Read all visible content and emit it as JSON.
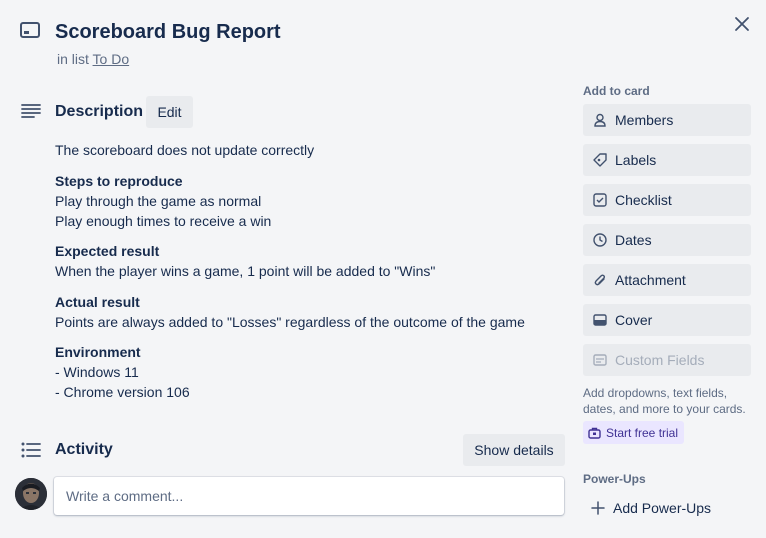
{
  "card": {
    "title": "Scoreboard Bug Report",
    "in_list_prefix": "in list",
    "list_name": "To Do"
  },
  "description": {
    "heading": "Description",
    "edit_label": "Edit",
    "intro": "The scoreboard does not update correctly",
    "steps_heading": "Steps to reproduce",
    "steps": [
      "Play through the game as normal",
      "Play enough times to receive a win"
    ],
    "expected_heading": "Expected result",
    "expected": "When the player wins a game, 1 point will be added to \"Wins\"",
    "actual_heading": "Actual result",
    "actual": "Points are always added to \"Losses\" regardless of the outcome of the game",
    "env_heading": "Environment",
    "env": [
      "- Windows 11",
      "- Chrome version 106"
    ]
  },
  "activity": {
    "heading": "Activity",
    "show_details_label": "Show details",
    "comment_placeholder": "Write a comment..."
  },
  "sidebar": {
    "add_to_card_heading": "Add to card",
    "buttons": [
      {
        "label": "Members",
        "icon": "person-icon"
      },
      {
        "label": "Labels",
        "icon": "tag-icon"
      },
      {
        "label": "Checklist",
        "icon": "checkbox-icon"
      },
      {
        "label": "Dates",
        "icon": "clock-icon"
      },
      {
        "label": "Attachment",
        "icon": "paperclip-icon"
      },
      {
        "label": "Cover",
        "icon": "card-cover-icon"
      },
      {
        "label": "Custom Fields",
        "icon": "custom-fields-icon"
      }
    ],
    "custom_fields_help": "Add dropdowns, text fields, dates, and more to your cards.",
    "trial_label": "Start free trial",
    "powerups_heading": "Power-Ups",
    "add_powerups_label": "Add Power-Ups"
  },
  "colors": {
    "background": "#f4f5f7",
    "button_bg": "#e9ebee",
    "text": "#172b4d",
    "muted": "#5e6c84",
    "trial_bg": "#eae6ff",
    "trial_text": "#403294"
  }
}
